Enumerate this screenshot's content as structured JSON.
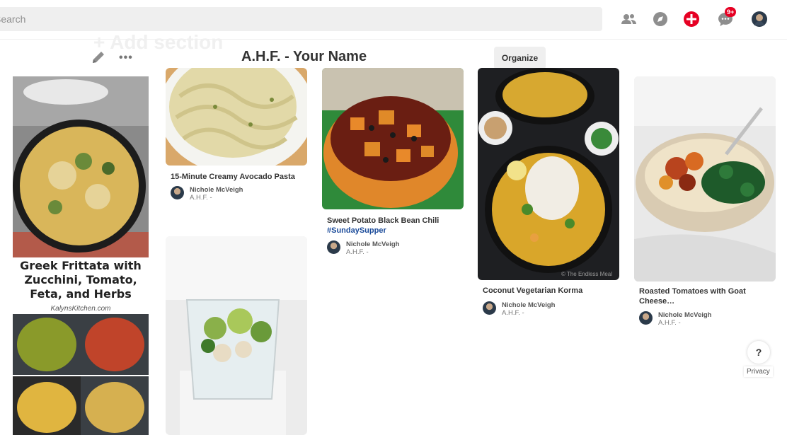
{
  "header": {
    "search_placeholder": "Search",
    "notifications_badge": "9+"
  },
  "board": {
    "title": "A.H.F. - ",
    "owner": "Your Name",
    "ghost_text": "+ Add section",
    "more_label": "•••",
    "organize_label": "Organize"
  },
  "pins": [
    {
      "title": "",
      "image_text": [
        "Greek Frittata with",
        "Zucchini, Tomato,",
        "Feta, and Herbs"
      ],
      "image_source": "KalynsKitchen.com"
    },
    {
      "title": "15-Minute Creamy Avocado Pasta",
      "pinner": "Nichole McVeigh",
      "board": "A.H.F. -"
    },
    {
      "title": "Sweet Potato Black Bean Chili ",
      "tag": "#SundaySupper",
      "pinner": "Nichole McVeigh",
      "board": "A.H.F. -"
    },
    {
      "title": "Coconut Vegetarian Korma",
      "image_credit": "© The Endless Meal",
      "pinner": "Nichole McVeigh",
      "board": "A.H.F. -"
    },
    {
      "title": "Roasted Tomatoes with Goat Cheese…",
      "pinner": "Nichole McVeigh",
      "board": "A.H.F. -"
    }
  ],
  "footer": {
    "help_label": "?",
    "privacy_label": "Privacy"
  },
  "colors": {
    "accent": "#e60023",
    "tag": "#1b4b9a",
    "search_bg": "#efefef"
  }
}
